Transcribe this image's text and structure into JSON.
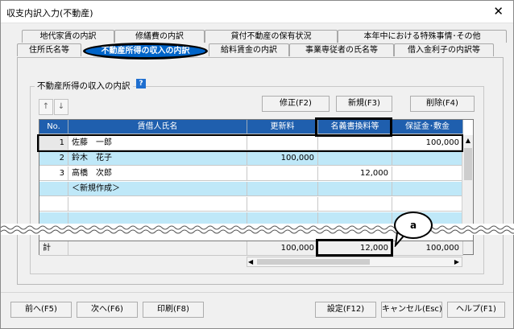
{
  "window": {
    "title": "収支内訳入力(不動産)",
    "close_glyph": "✕"
  },
  "tabs_back": [
    "地代家賃の内訳",
    "修繕費の内訳",
    "貸付不動産の保有状況",
    "本年中における特殊事情･その他"
  ],
  "tabs_front": [
    "住所氏名等",
    "不動産所得の収入の内訳",
    "給料賃金の内訳",
    "事業専従者の氏名等",
    "借入金利子の内訳等"
  ],
  "group": {
    "label": "不動産所得の収入の内訳",
    "help": "?"
  },
  "row_buttons": {
    "up": "↑",
    "down": "↓",
    "edit": "修正(F2)",
    "new": "新規(F3)",
    "delete": "削除(F4)"
  },
  "table": {
    "headers": [
      "No.",
      "賃借人氏名",
      "更新料",
      "名義書換料等",
      "保証金･敷金"
    ],
    "rows": [
      {
        "no": "1",
        "name": "佐藤　一郎",
        "renewal": "",
        "transfer": "",
        "deposit": "100,000"
      },
      {
        "no": "2",
        "name": "鈴木　花子",
        "renewal": "100,000",
        "transfer": "",
        "deposit": ""
      },
      {
        "no": "3",
        "name": "高橋　次郎",
        "renewal": "",
        "transfer": "12,000",
        "deposit": ""
      }
    ],
    "new_row": "＜新規作成＞",
    "totals": {
      "label": "計",
      "renewal": "100,000",
      "transfer": "12,000",
      "deposit": "100,000"
    }
  },
  "callout": {
    "letter": "a"
  },
  "scroll": {
    "up": "▲",
    "down": "▼",
    "left": "◀",
    "right": "▶"
  },
  "footer_buttons": {
    "prev": "前へ(F5)",
    "next": "次へ(F6)",
    "print": "印刷(F8)",
    "settings": "設定(F12)",
    "cancel": "キャンセル(Esc)",
    "help": "ヘルプ(F1)"
  }
}
